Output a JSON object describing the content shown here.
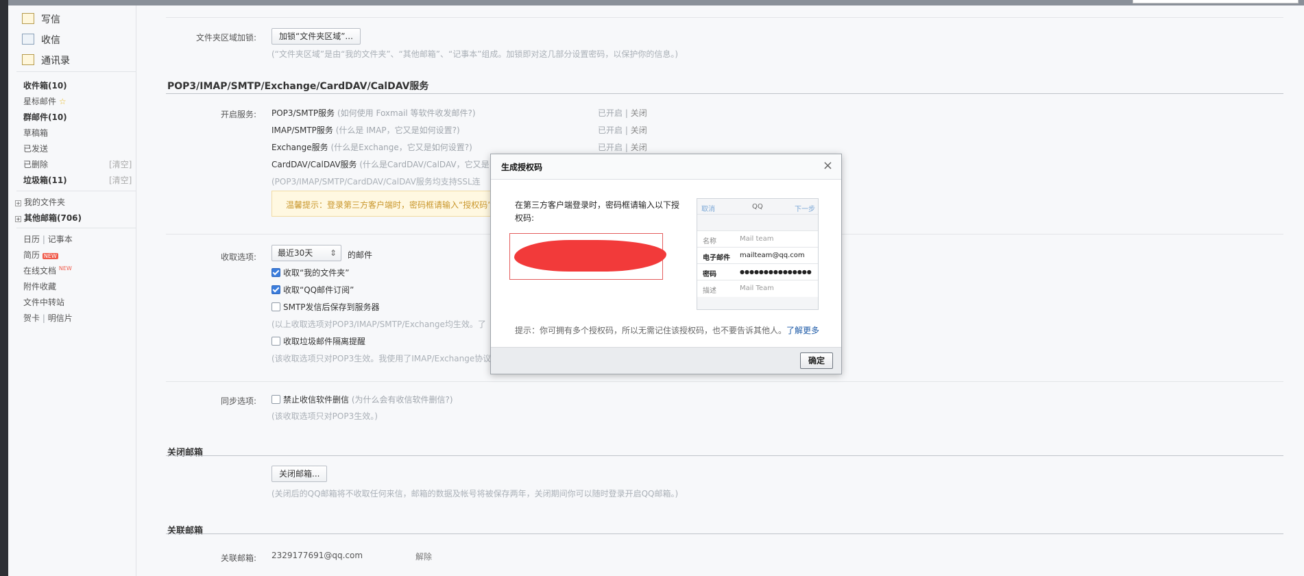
{
  "sidebar": {
    "compose": "写信",
    "receive": "收信",
    "contacts": "通讯录",
    "folders": [
      {
        "label": "收件箱(10)",
        "bold": true
      },
      {
        "label": "星标邮件",
        "star": "☆"
      },
      {
        "label": "群邮件(10)",
        "bold": true
      },
      {
        "label": "草稿箱"
      },
      {
        "label": "已发送"
      },
      {
        "label": "已删除",
        "action": "[清空]"
      },
      {
        "label": "垃圾箱(11)",
        "bold": true,
        "action": "[清空]"
      }
    ],
    "my_folders": "我的文件夹",
    "other_mail": "其他邮箱(706)",
    "tools": {
      "calendar": "日历",
      "notes": "记事本",
      "resume": "简历",
      "resume_badge": "NEW",
      "docs": "在线文档",
      "docs_badge": "NEW",
      "attachments": "附件收藏",
      "transfer": "文件中转站",
      "cards": "贺卡",
      "postcards": "明信片",
      "pipe": "|"
    }
  },
  "main": {
    "folder_lock_label": "文件夹区域加锁:",
    "folder_lock_button": "加锁“文件夹区域”...",
    "folder_lock_hint": "(“文件夹区域”是由“我的文件夹”、“其他邮箱”、“记事本”组成。加锁即对这几部分设置密码，以保护你的信息。)",
    "pop_section_title": "POP3/IMAP/SMTP/Exchange/CardDAV/CalDAV服务",
    "services_label": "开启服务:",
    "services": [
      {
        "name": "POP3/SMTP服务",
        "help": "(如何使用 Foxmail 等软件收发邮件?)",
        "status": "已开启",
        "sep": "|",
        "action": "关闭"
      },
      {
        "name": "IMAP/SMTP服务",
        "help": "(什么是 IMAP，它又是如何设置?)",
        "status": "已开启",
        "sep": "|",
        "action": "关闭"
      },
      {
        "name": "Exchange服务",
        "help": "(什么是Exchange，它又是如何设置?)",
        "status": "已开启",
        "sep": "|",
        "action": "关闭"
      },
      {
        "name": "CardDAV/CalDAV服务",
        "help": "(什么是CardDAV/CalDAV，它又是",
        "status": "",
        "sep": "",
        "action": ""
      }
    ],
    "ssl_hint": "(POP3/IMAP/SMTP/CardDAV/CalDAV服务均支持SSL连",
    "warning": "温馨提示：登录第三方客户端时，密码框请输入“授权码”",
    "receive_label": "收取选项:",
    "receive_select": "最近30天",
    "receive_suffix": "的邮件",
    "receive_opts": [
      {
        "label": "收取“我的文件夹”",
        "checked": true
      },
      {
        "label": "收取“QQ邮件订阅”",
        "checked": true
      },
      {
        "label": "SMTP发信后保存到服务器",
        "checked": false
      }
    ],
    "receive_hint1": "(以上收取选项对POP3/IMAP/SMTP/Exchange均生效。了",
    "junk_opt": "收取垃圾邮件隔离提醒",
    "receive_hint2": "(该收取选项只对POP3生效。我使用了IMAP/Exchange协议",
    "sync_label": "同步选项:",
    "sync_opt": "禁止收信软件删信",
    "sync_help": "(为什么会有收信软件删信?)",
    "sync_hint": "(该收取选项只对POP3生效。)",
    "close_title": "关闭邮箱",
    "close_button": "关闭邮箱...",
    "close_hint": "(关闭后的QQ邮箱将不收取任何来信，邮箱的数据及帐号将被保存两年，关闭期间你可以随时登录开启QQ邮箱。)",
    "linked_title": "关联邮箱",
    "linked_label": "关联邮箱:",
    "linked_email": "2329177691@qq.com",
    "linked_action": "解除"
  },
  "dialog": {
    "title": "生成授权码",
    "close": "×",
    "instruction": "在第三方客户端登录时，密码框请输入以下授权码:",
    "phone": {
      "cancel": "取消",
      "title": "QQ",
      "next": "下一步",
      "rows": [
        {
          "k": "名称",
          "v": "Mail team"
        },
        {
          "k": "电子邮件",
          "v": "mailteam@qq.com"
        },
        {
          "k": "密码",
          "v": "●●●●●●●●●●●●●●●"
        },
        {
          "k": "描述",
          "v": "Mail Team"
        }
      ]
    },
    "tip": "提示：你可拥有多个授权码，所以无需记住该授权码，也不要告诉其他人。",
    "learn_more": "了解更多",
    "ok": "确定"
  },
  "colors": {
    "accent": "#3b7ddd",
    "redact": "#f23a3a",
    "warn_bg": "#fff8e1"
  }
}
